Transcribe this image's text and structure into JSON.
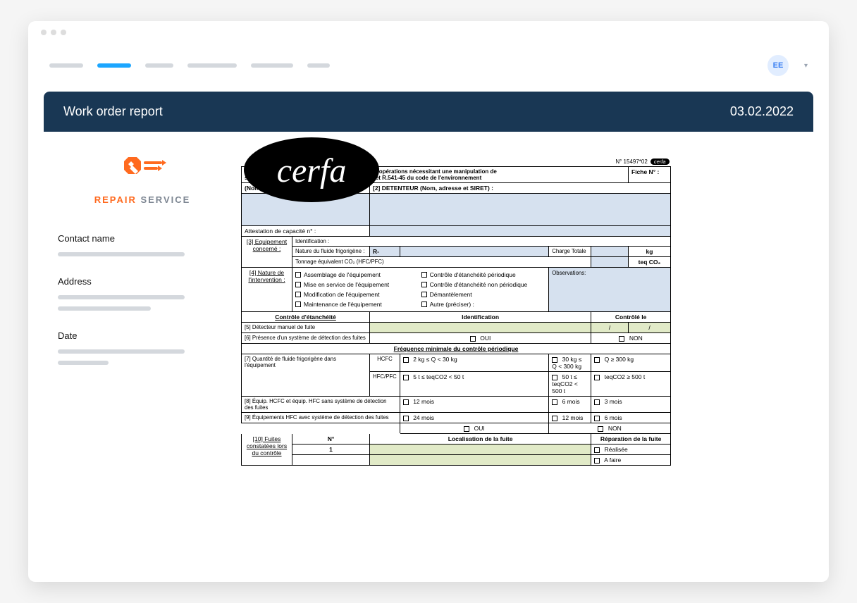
{
  "avatar": "EE",
  "card": {
    "title": "Work order report",
    "date": "03.02.2022"
  },
  "logo": {
    "r": "REPAIR ",
    "s": "SERVICE"
  },
  "side": {
    "contact": "Contact name",
    "address": "Address",
    "date": "Date"
  },
  "cerfa": "cerfa",
  "form": {
    "docNum": "N° 15497*02",
    "docTag": "cerfa",
    "ficheN": "Fiche N° :",
    "headerLine1": "AU DE SUIVI DE DÉCHETS DANGEREUX pour les opérations nécessitant une manipulation de",
    "headerLine2": "sur un équipement, prévus aux articles R.543-82 et R.541-45 du code de l'environnement",
    "op1": "(Nom, adresse et SIRET):",
    "op2": "[2] DETENTEUR  (Nom, adresse et SIRET) :",
    "attest": "Attestation de capacité n° :",
    "sec3": "[3] Equipement concerné :",
    "ident": "Identification :",
    "nature": "Nature du fluide frigorigène :",
    "r": "R-",
    "charge": "Charge Totale",
    "kg": "kg",
    "tonnage": "Tonnage équivalent CO₂ (HFC/PFC)",
    "teq": "teq CO₂",
    "sec4": "[4] Nature de l'intervention :",
    "chk": {
      "a": "Assemblage de l'équipement",
      "b": "Mise en service de l'équipement",
      "c": "Modification de l'équipement",
      "d": "Maintenance de l'équipement",
      "e": "Contrôle d'étanchéité périodique",
      "f": "Contrôle d'étanchéité non périodique",
      "g": "Démantèlement",
      "h": "Autre (préciser) :"
    },
    "obs": "Observations:",
    "colA": "Contrôle d'étanchéité",
    "colB": "Identification",
    "colC": "Contrôlé le",
    "row5": "[5] Détecteur manuel de fuite",
    "row6": "[6] Présence d'un système de détection des fuites",
    "oui": "OUI",
    "non": "NON",
    "freq": "Fréquence minimale du contrôle périodique",
    "row7": "[7] Quantité de fluide frigorigène dans l'équipement",
    "hcfc": "HCFC",
    "hfc": "HFC/PFC",
    "q1": "2 kg ≤  Q < 30 kg",
    "q2": "30 kg ≤ Q < 300 kg",
    "q3": "Q  ≥ 300 kg",
    "q4": "5 t ≤ teqCO2 < 50 t",
    "q5": "50 t ≤ teqCO2 < 500 t",
    "q6": "teqCO2 ≥ 500 t",
    "row8": "[8] Équip. HCFC et équip. HFC sans système de détection des fuites",
    "row9": "[9] Équipements HFC avec système de détection des fuites",
    "m12": "12 mois",
    "m6": "6 mois",
    "m3": "3 mois",
    "m24": "24 mois",
    "sec10": "[10] Fuites constatées lors du contrôle",
    "nCol": "N°",
    "locCol": "Localisation de la fuite",
    "repCol": "Réparation de la fuite",
    "real": "Réalisée",
    "afaire": "A faire",
    "slash": "/"
  }
}
